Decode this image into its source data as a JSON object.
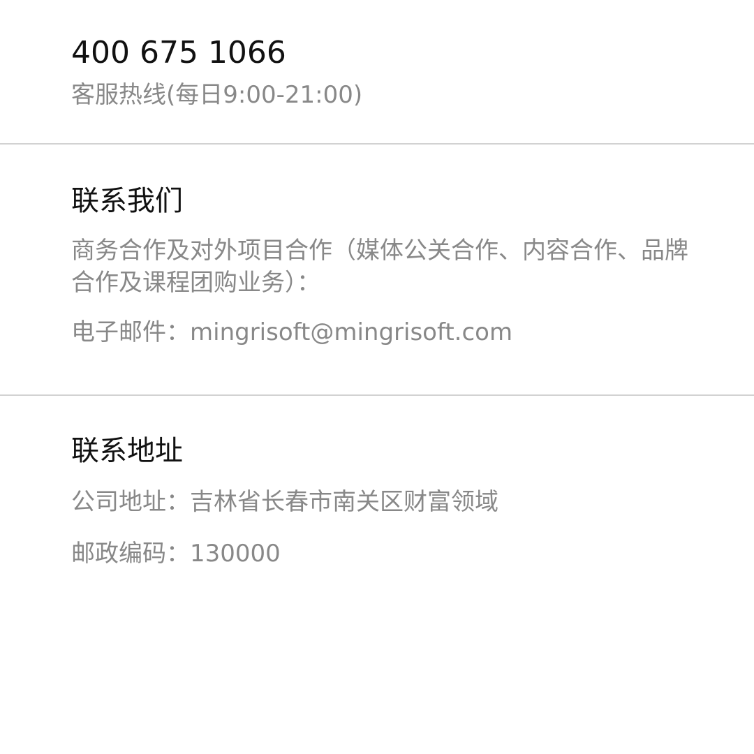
{
  "hotline": {
    "phone": "400 675 1066",
    "label": "客服热线(每日9:00-21:00)"
  },
  "contact_us": {
    "title": "联系我们",
    "description": "商务合作及对外项目合作（媒体公关合作、内容合作、品牌合作及课程团购业务）：",
    "email": "电子邮件：mingrisoft@mingrisoft.com"
  },
  "contact_address": {
    "title": "联系地址",
    "address": "公司地址：吉林省长春市南关区财富领域",
    "postal_code": "邮政编码：130000"
  },
  "colors": {
    "primary_text": "#111111",
    "secondary_text": "#888888",
    "divider": "#d2d2d2",
    "background": "#ffffff"
  }
}
